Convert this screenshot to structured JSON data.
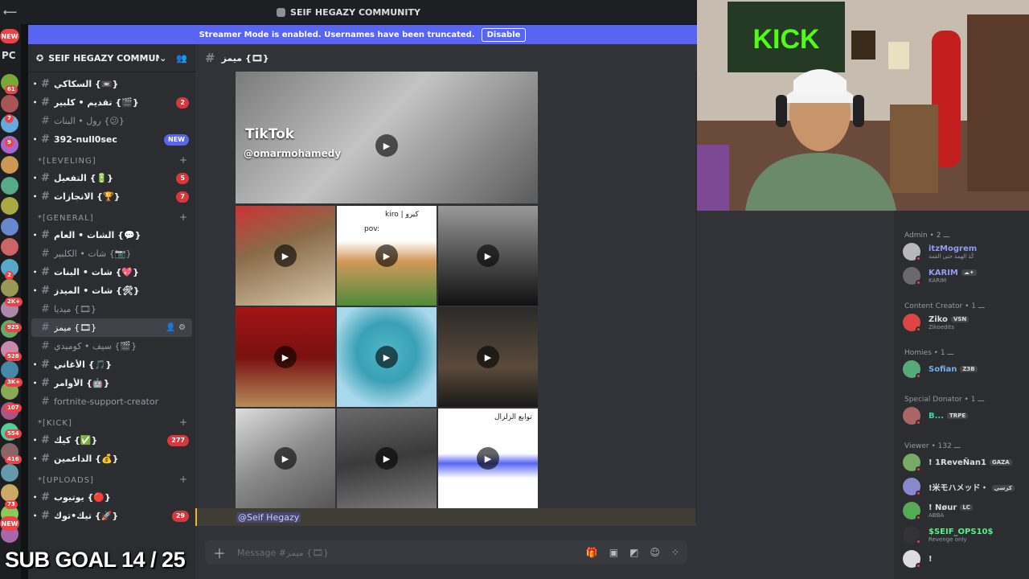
{
  "window": {
    "title": "SEIF HEGAZY COMMUNITY"
  },
  "banner": {
    "text": "Streamer Mode is enabled. Usernames have been truncated.",
    "button": "Disable"
  },
  "guilds": {
    "new_top": "NEW",
    "pc": "PC",
    "new_bottom": "NEW",
    "badges": [
      "61",
      "7",
      "9",
      "2",
      "2K+",
      "925",
      "528",
      "3K+",
      "107",
      "554",
      "416",
      "73"
    ]
  },
  "server": {
    "name": "SEIF HEGAZY COMMUNI..."
  },
  "sidebar": {
    "channels": [
      {
        "label": "السكاكي {📼}",
        "unread": true
      },
      {
        "label": "تقديم • كلبير {🎬}",
        "unread": true,
        "badge": "2"
      },
      {
        "label": "رول • البنات {😕}",
        "unread": false
      },
      {
        "label": "392-null0sec",
        "unread": true,
        "newb": "NEW"
      }
    ],
    "cat_leveling": "*[LEVELING]",
    "leveling": [
      {
        "label": "التفعيل {🔋}",
        "unread": true,
        "badge": "5"
      },
      {
        "label": "الانجازات {🏆}",
        "unread": true,
        "badge": "7"
      }
    ],
    "cat_general": "*[GENERAL]",
    "general": [
      {
        "label": "الشات • العام {💬}",
        "unread": true
      },
      {
        "label": "شات • الكلبير {📷}",
        "unread": false
      },
      {
        "label": "شات • البنات {💖}",
        "unread": true
      },
      {
        "label": "شات • الميدز {🛠}",
        "unread": true
      },
      {
        "label": "ميديا {🎞}",
        "unread": false
      },
      {
        "label": "ميمز {🎞}",
        "active": true
      },
      {
        "label": "سيف • كوميدي {🎬}",
        "unread": false
      },
      {
        "label": "الأغاني {🎵}",
        "unread": true
      },
      {
        "label": "الأوامر {🤖}",
        "unread": true
      },
      {
        "label": "fortnite-support-creator",
        "unread": false
      }
    ],
    "cat_kick": "*[KICK]",
    "kick": [
      {
        "label": "كيك {✅}",
        "unread": true,
        "badge": "277"
      },
      {
        "label": "الداعمين {💰}",
        "unread": true
      }
    ],
    "cat_uploads": "*[UPLOADS]",
    "uploads": [
      {
        "label": "يوتيوب {🔴}",
        "unread": true
      },
      {
        "label": "تيك•توك {🚀}",
        "unread": true,
        "badge": "29"
      }
    ]
  },
  "channel": {
    "name": "ميمز {🎞}"
  },
  "attachments": {
    "big_logo": "TikTok",
    "big_handle": "@omarmohamedy",
    "thumb2_caption": "kiro | كيرو",
    "thumb2_pov": "pov:",
    "thumb9_caption": "توابع الزلزال"
  },
  "message": {
    "mention": "@Seif Hegazy"
  },
  "composer": {
    "placeholder": "Message #ميمز {🎞}"
  },
  "members": {
    "groups": [
      {
        "role": "Admin • ـــ 2",
        "items": [
          {
            "name": "itzMogrem",
            "status": "كُدَ الهمة حتى القمة",
            "color": "#949cf7",
            "av": "#b8b8b8"
          },
          {
            "name": "KARIM",
            "tag": "☁✦",
            "status": "KARIM",
            "color": "#949cf7",
            "av": "#6a6a6a"
          }
        ]
      },
      {
        "role": "Content Creator • ـــ 1",
        "items": [
          {
            "name": "Ziko",
            "tag": "VSN",
            "status": "Zikoedits",
            "color": "#dbdee1",
            "av": "#d44"
          }
        ]
      },
      {
        "role": "Homies • ـــ 1",
        "items": [
          {
            "name": "Sofian",
            "tag": "Z3B",
            "color": "#6fb0f0",
            "av": "#5a7"
          }
        ]
      },
      {
        "role": "Special Donator • ـــ 1",
        "items": [
          {
            "name": "B...",
            "tag": "TRPE",
            "color": "#3dd6a8",
            "av": "#a66"
          }
        ]
      },
      {
        "role": "Viewer • ـــ 132",
        "items": [
          {
            "name": "! 1ReveÑan1",
            "tag": "GAZA",
            "color": "#dbdee1",
            "av": "#7a6"
          },
          {
            "name": "!米モハメッド・",
            "tag": "كرسي",
            "color": "#dbdee1",
            "av": "#88c"
          },
          {
            "name": "! Nøur",
            "tag": "LC",
            "status": "ABBA",
            "color": "#dbdee1",
            "av": "#5a5"
          },
          {
            "name": "$SEIF_OPS10$",
            "status": "Revenge only",
            "color": "#57f287",
            "av": "#333"
          },
          {
            "name": "!",
            "color": "#dbdee1",
            "av": "#ddd"
          }
        ]
      }
    ]
  },
  "overlay": {
    "subgoal": "SUB GOAL 14 / 25"
  },
  "colors": {
    "accent": "#5865f2",
    "badge": "#da373c",
    "sidebar": "#2b2d31",
    "chat": "#313338"
  }
}
